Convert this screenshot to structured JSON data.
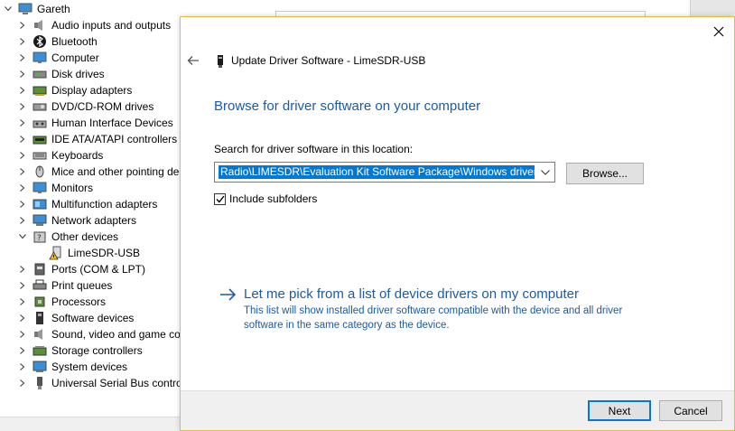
{
  "device_tree": {
    "root": {
      "label": "Gareth",
      "icon": "computer-icon"
    },
    "items": [
      {
        "label": "Audio inputs and outputs",
        "icon": "speaker-icon",
        "expanded": false
      },
      {
        "label": "Bluetooth",
        "icon": "bluetooth-icon",
        "expanded": false
      },
      {
        "label": "Computer",
        "icon": "monitor-icon",
        "expanded": false
      },
      {
        "label": "Disk drives",
        "icon": "disk-drive-icon",
        "expanded": false
      },
      {
        "label": "Display adapters",
        "icon": "display-adapter-icon",
        "expanded": false
      },
      {
        "label": "DVD/CD-ROM drives",
        "icon": "dvd-drive-icon",
        "expanded": false
      },
      {
        "label": "Human Interface Devices",
        "icon": "hid-icon",
        "expanded": false
      },
      {
        "label": "IDE ATA/ATAPI controllers",
        "icon": "ide-controller-icon",
        "expanded": false
      },
      {
        "label": "Keyboards",
        "icon": "keyboard-icon",
        "expanded": false
      },
      {
        "label": "Mice and other pointing de",
        "icon": "mouse-icon",
        "expanded": false
      },
      {
        "label": "Monitors",
        "icon": "monitor-icon",
        "expanded": false
      },
      {
        "label": "Multifunction adapters",
        "icon": "multifunction-icon",
        "expanded": false
      },
      {
        "label": "Network adapters",
        "icon": "network-adapter-icon",
        "expanded": false
      },
      {
        "label": "Other devices",
        "icon": "unknown-device-icon",
        "expanded": true,
        "children": [
          {
            "label": "LimeSDR-USB",
            "icon": "warning-device-icon"
          }
        ]
      },
      {
        "label": "Ports (COM & LPT)",
        "icon": "port-icon",
        "expanded": false
      },
      {
        "label": "Print queues",
        "icon": "printer-icon",
        "expanded": false
      },
      {
        "label": "Processors",
        "icon": "processor-icon",
        "expanded": false
      },
      {
        "label": "Software devices",
        "icon": "software-device-icon",
        "expanded": false
      },
      {
        "label": "Sound, video and game co",
        "icon": "speaker-icon",
        "expanded": false
      },
      {
        "label": "Storage controllers",
        "icon": "storage-controller-icon",
        "expanded": false
      },
      {
        "label": "System devices",
        "icon": "system-device-icon",
        "expanded": false
      },
      {
        "label": "Universal Serial Bus contro",
        "icon": "usb-icon",
        "expanded": false
      }
    ]
  },
  "dialog": {
    "title": "Update Driver Software - LimeSDR-USB",
    "heading": "Browse for driver software on your computer",
    "search_label": "Search for driver software in this location:",
    "path_value": "Radio\\LIMESDR\\Evaluation Kit Software Package\\Windows drivers",
    "browse_label": "Browse...",
    "include_subfolders_label": "Include subfolders",
    "include_subfolders_checked": true,
    "pick_title": "Let me pick from a list of device drivers on my computer",
    "pick_description": "This list will show installed driver software compatible with the device and all driver software in the same category as the device.",
    "next_label": "Next",
    "cancel_label": "Cancel"
  },
  "colors": {
    "link_blue": "#1c5aa6",
    "selection_blue": "#0078d7",
    "dialog_border": "#e8b93c",
    "footer_bg": "#f0f0f0"
  }
}
